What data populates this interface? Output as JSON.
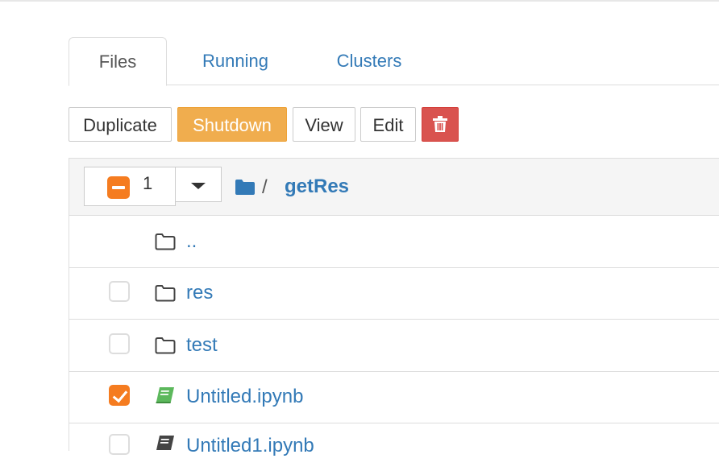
{
  "tabs": [
    {
      "label": "Files",
      "active": true
    },
    {
      "label": "Running",
      "active": false
    },
    {
      "label": "Clusters",
      "active": false
    }
  ],
  "toolbar": {
    "duplicate_label": "Duplicate",
    "shutdown_label": "Shutdown",
    "view_label": "View",
    "edit_label": "Edit",
    "delete_icon": "trash-icon"
  },
  "list_header": {
    "selected_count": "1",
    "breadcrumb_separator": "/",
    "current_folder": "getRes"
  },
  "items": [
    {
      "name": "..",
      "type": "folder",
      "checked": false,
      "checkbox": false
    },
    {
      "name": "res",
      "type": "folder",
      "checked": false,
      "checkbox": true
    },
    {
      "name": "test",
      "type": "folder",
      "checked": false,
      "checkbox": true
    },
    {
      "name": "Untitled.ipynb",
      "type": "notebook-running",
      "checked": true,
      "checkbox": true
    },
    {
      "name": "Untitled1.ipynb",
      "type": "notebook",
      "checked": false,
      "checkbox": true
    }
  ],
  "colors": {
    "link": "#337ab7",
    "warning": "#f0ad4e",
    "danger": "#d9534f",
    "check": "#f57c20",
    "running_notebook": "#5cb85c"
  }
}
